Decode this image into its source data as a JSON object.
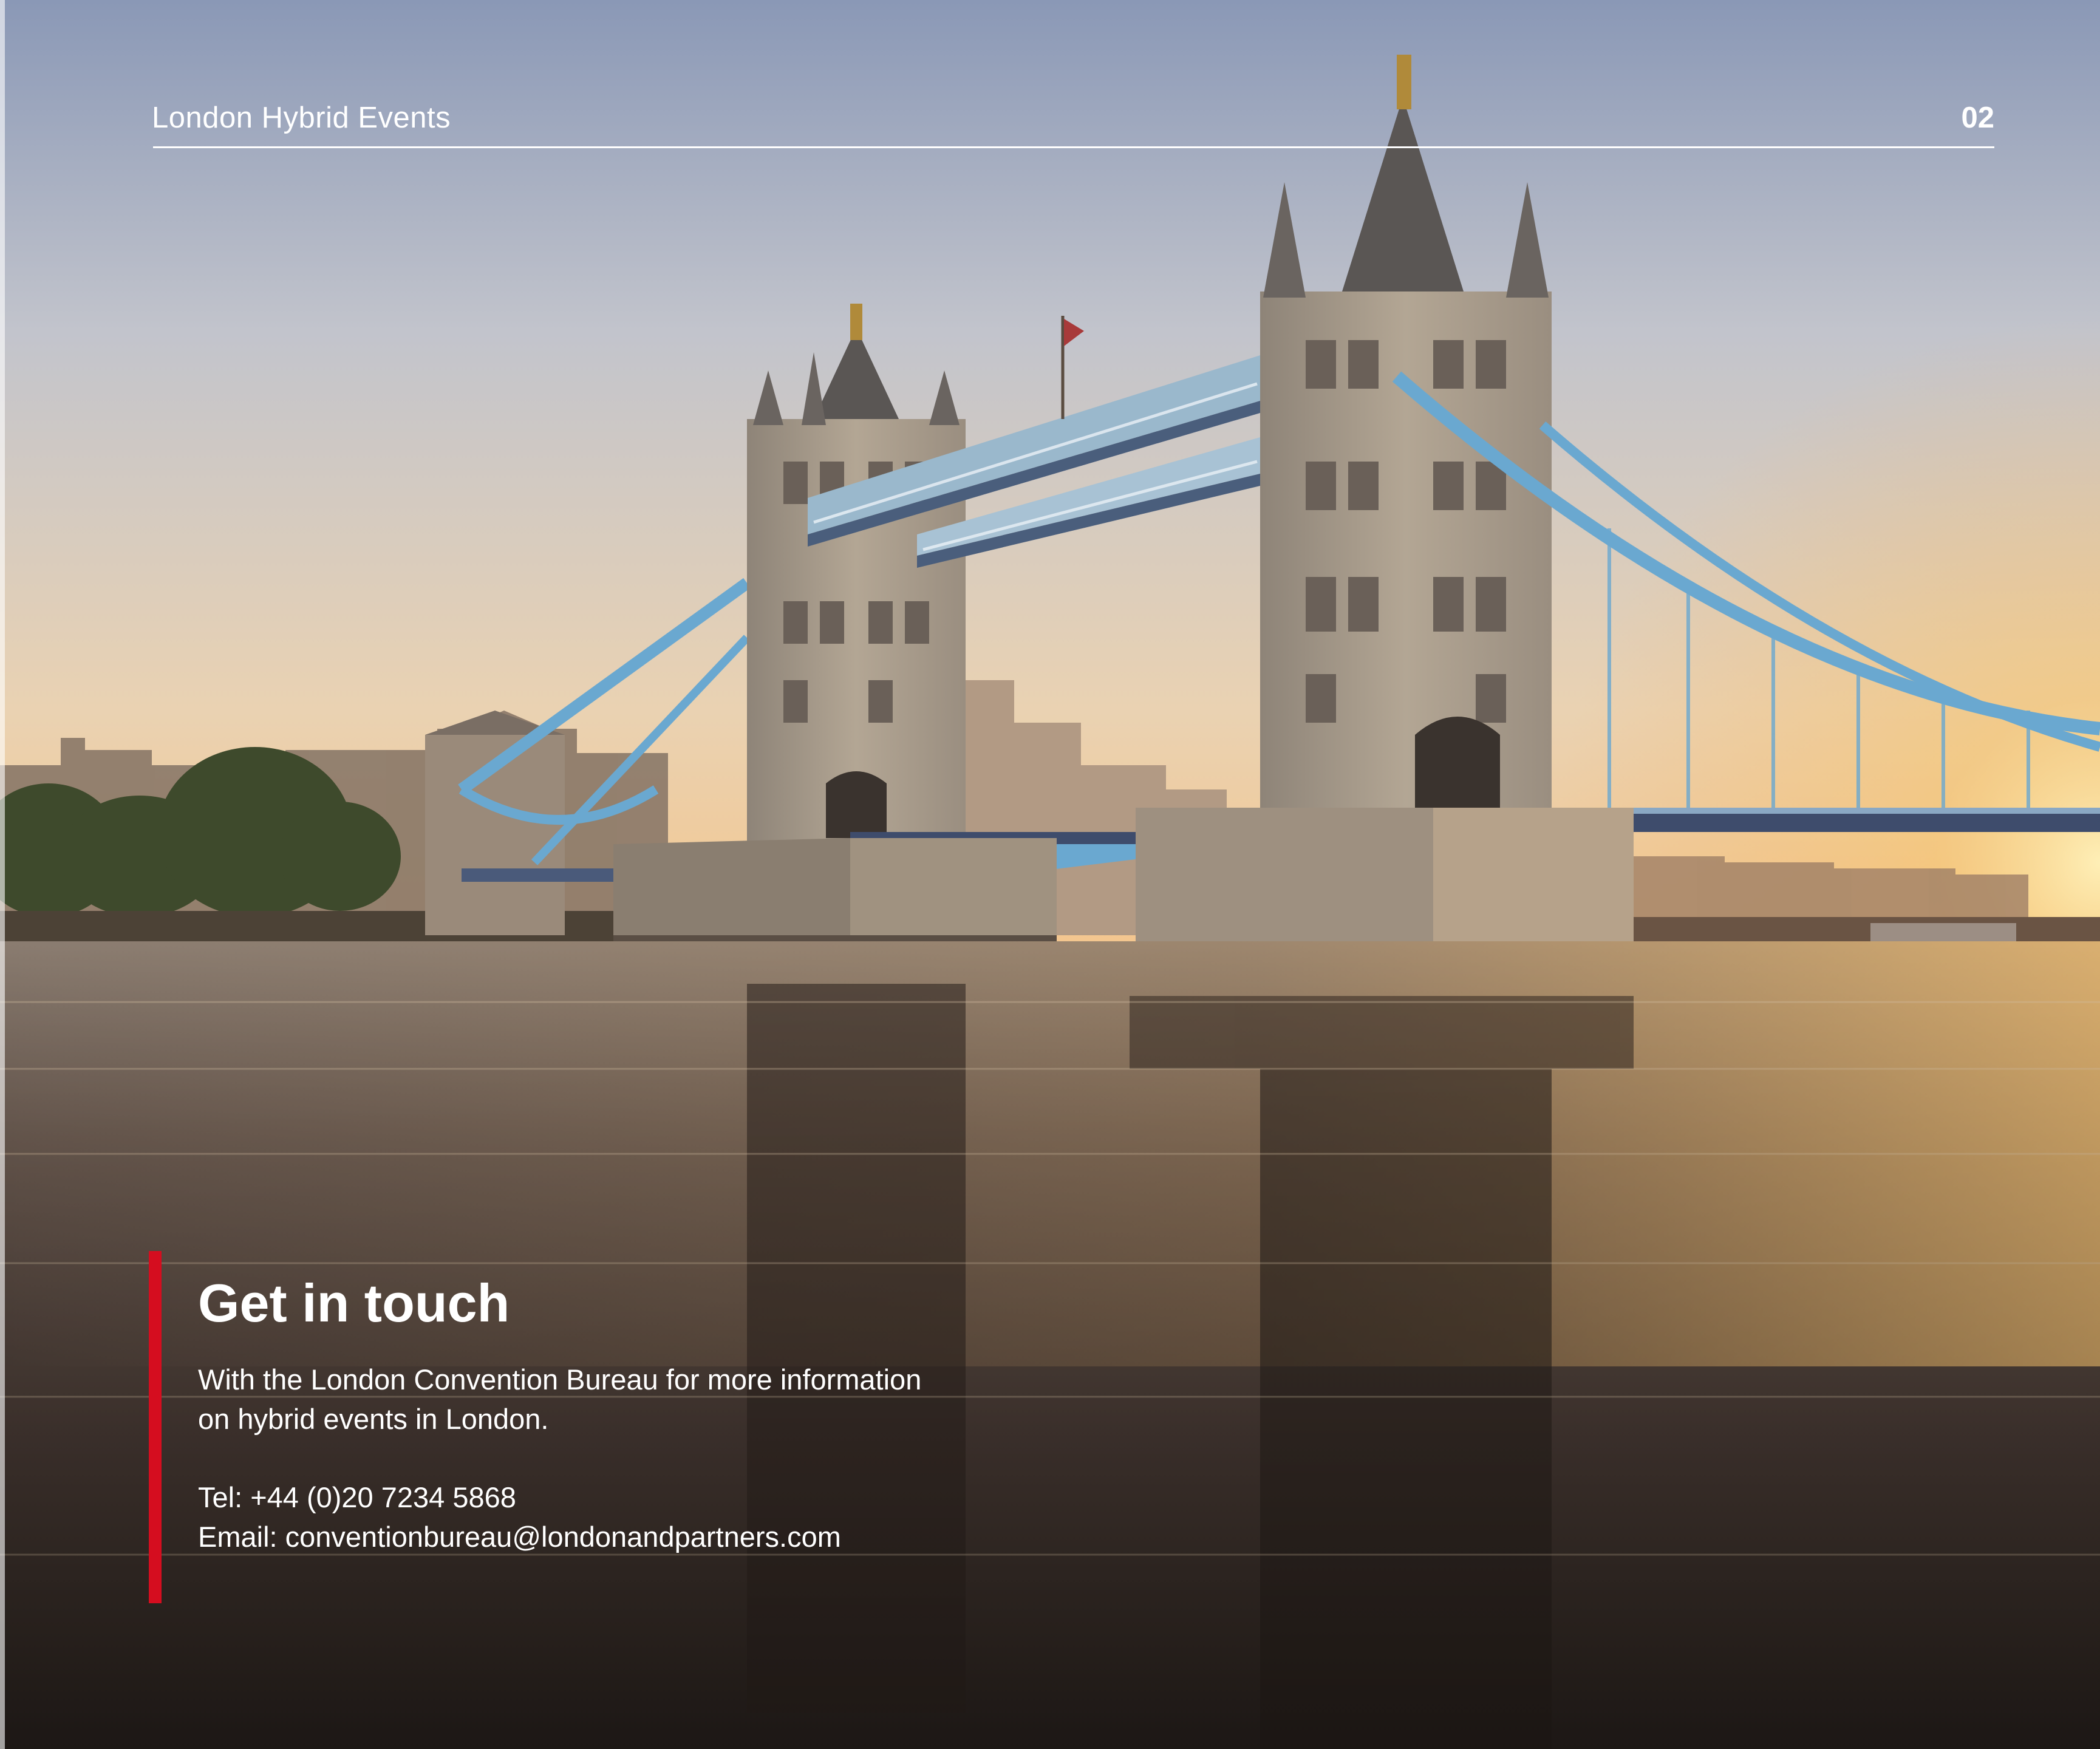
{
  "header": {
    "title": "London Hybrid Events",
    "page_number": "02"
  },
  "contact": {
    "heading": "Get in touch",
    "intro_line1": "With the London Convention Bureau for more information",
    "intro_line2": "on hybrid events in London.",
    "tel": "Tel: +44 (0)20 7234 5868",
    "email": "Email: conventionbureau@londonandpartners.com"
  },
  "colors": {
    "accent": "#d50d1f",
    "text": "#ffffff",
    "bridge_blue": "#5aa0c8",
    "stone": "#a89a88",
    "sky_top": "#8e9cb8",
    "sky_bottom": "#f2c99a"
  },
  "image": {
    "subject": "tower-bridge-photo"
  }
}
